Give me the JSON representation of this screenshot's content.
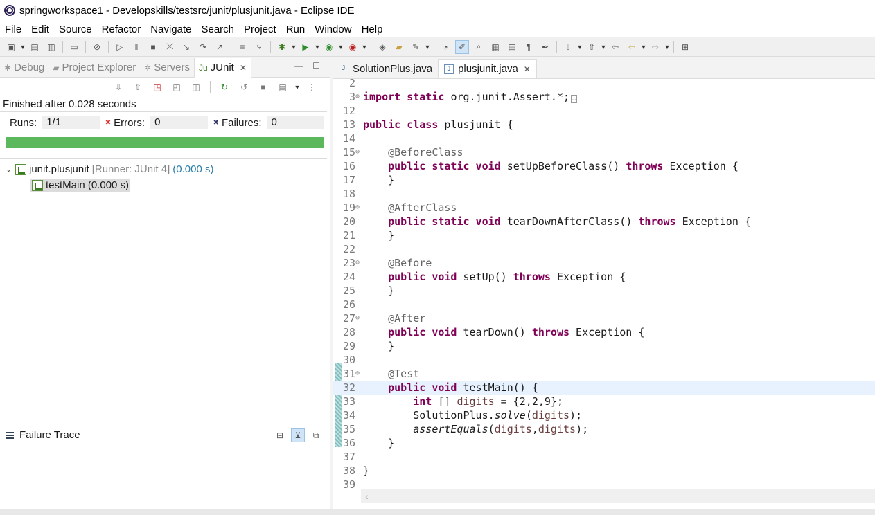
{
  "window": {
    "title": "springworkspace1 - Developskills/testsrc/junit/plusjunit.java - Eclipse IDE"
  },
  "menu": [
    "File",
    "Edit",
    "Source",
    "Refactor",
    "Navigate",
    "Search",
    "Project",
    "Run",
    "Window",
    "Help"
  ],
  "left_tabs": [
    {
      "label": "Debug",
      "icon": "debug-icon"
    },
    {
      "label": "Project Explorer",
      "icon": "project-explorer-icon"
    },
    {
      "label": "Servers",
      "icon": "servers-icon"
    },
    {
      "label": "JUnit",
      "icon": "junit-icon"
    }
  ],
  "junit": {
    "status": "Finished after 0.028 seconds",
    "runs_label": "Runs:",
    "runs": "1/1",
    "errors_label": "Errors:",
    "errors": "0",
    "failures_label": "Failures:",
    "failures": "0",
    "progress_color": "#5cb85c",
    "suite": {
      "name": "junit.plusjunit",
      "runner": "[Runner: JUnit 4]",
      "time": "(0.000 s)"
    },
    "test": {
      "name": "testMain (0.000 s)"
    },
    "failure_trace_label": "Failure Trace"
  },
  "editor_tabs": [
    {
      "label": "SolutionPlus.java"
    },
    {
      "label": "plusjunit.java"
    }
  ],
  "code_lines": [
    {
      "num": "2",
      "fold": "",
      "tokens": []
    },
    {
      "num": "3",
      "fold": "⊕",
      "tokens": [
        [
          "kw",
          "import static"
        ],
        [
          "",
          "org.junit.Assert.*;"
        ],
        [
          "box",
          "…"
        ]
      ]
    },
    {
      "num": "12",
      "fold": "",
      "tokens": []
    },
    {
      "num": "13",
      "fold": "",
      "tokens": [
        [
          "kw",
          "public class"
        ],
        [
          "",
          "plusjunit {"
        ]
      ]
    },
    {
      "num": "14",
      "fold": "",
      "tokens": []
    },
    {
      "num": "15",
      "fold": "⊖",
      "tokens": [
        [
          "",
          "    "
        ],
        [
          "ann",
          "@BeforeClass"
        ]
      ]
    },
    {
      "num": "16",
      "fold": "",
      "tokens": [
        [
          "",
          "    "
        ],
        [
          "kw",
          "public static void"
        ],
        [
          "",
          " setUpBeforeClass() "
        ],
        [
          "kw",
          "throws"
        ],
        [
          "",
          " Exception {"
        ]
      ]
    },
    {
      "num": "17",
      "fold": "",
      "tokens": [
        [
          "",
          "    }"
        ]
      ]
    },
    {
      "num": "18",
      "fold": "",
      "tokens": []
    },
    {
      "num": "19",
      "fold": "⊖",
      "tokens": [
        [
          "",
          "    "
        ],
        [
          "ann",
          "@AfterClass"
        ]
      ]
    },
    {
      "num": "20",
      "fold": "",
      "tokens": [
        [
          "",
          "    "
        ],
        [
          "kw",
          "public static void"
        ],
        [
          "",
          " tearDownAfterClass() "
        ],
        [
          "kw",
          "throws"
        ],
        [
          "",
          " Exception {"
        ]
      ]
    },
    {
      "num": "21",
      "fold": "",
      "tokens": [
        [
          "",
          "    }"
        ]
      ]
    },
    {
      "num": "22",
      "fold": "",
      "tokens": []
    },
    {
      "num": "23",
      "fold": "⊖",
      "tokens": [
        [
          "",
          "    "
        ],
        [
          "ann",
          "@Before"
        ]
      ]
    },
    {
      "num": "24",
      "fold": "",
      "tokens": [
        [
          "",
          "    "
        ],
        [
          "kw",
          "public void"
        ],
        [
          "",
          " setUp() "
        ],
        [
          "kw",
          "throws"
        ],
        [
          "",
          " Exception {"
        ]
      ]
    },
    {
      "num": "25",
      "fold": "",
      "tokens": [
        [
          "",
          "    }"
        ]
      ]
    },
    {
      "num": "26",
      "fold": "",
      "tokens": []
    },
    {
      "num": "27",
      "fold": "⊖",
      "tokens": [
        [
          "",
          "    "
        ],
        [
          "ann",
          "@After"
        ]
      ]
    },
    {
      "num": "28",
      "fold": "",
      "tokens": [
        [
          "",
          "    "
        ],
        [
          "kw",
          "public void"
        ],
        [
          "",
          " tearDown() "
        ],
        [
          "kw",
          "throws"
        ],
        [
          "",
          " Exception {"
        ]
      ]
    },
    {
      "num": "29",
      "fold": "",
      "tokens": [
        [
          "",
          "    }"
        ]
      ]
    },
    {
      "num": "30",
      "fold": "",
      "tokens": []
    },
    {
      "num": "31",
      "fold": "⊖",
      "tokens": [
        [
          "",
          "    "
        ],
        [
          "ann",
          "@Test"
        ]
      ]
    },
    {
      "num": "32",
      "fold": "",
      "current": true,
      "tokens": [
        [
          "",
          "    "
        ],
        [
          "kw",
          "public void"
        ],
        [
          "",
          " testMain() {"
        ]
      ]
    },
    {
      "num": "33",
      "fold": "",
      "tokens": [
        [
          "",
          "        "
        ],
        [
          "kw",
          "int"
        ],
        [
          "",
          "[] "
        ],
        [
          "var",
          "digits"
        ],
        [
          "",
          " = {2,2,9};"
        ]
      ]
    },
    {
      "num": "34",
      "fold": "",
      "tokens": [
        [
          "",
          "        SolutionPlus."
        ],
        [
          "it",
          "solve"
        ],
        [
          "",
          "("
        ],
        [
          "var",
          "digits"
        ],
        [
          "",
          ");"
        ]
      ]
    },
    {
      "num": "35",
      "fold": "",
      "tokens": [
        [
          "",
          "        "
        ],
        [
          "it",
          "assertEquals"
        ],
        [
          "",
          "("
        ],
        [
          "var",
          "digits"
        ],
        [
          "",
          ","
        ],
        [
          "var",
          "digits"
        ],
        [
          "",
          ");"
        ]
      ]
    },
    {
      "num": "36",
      "fold": "",
      "tokens": [
        [
          "",
          "    }"
        ]
      ]
    },
    {
      "num": "37",
      "fold": "",
      "tokens": []
    },
    {
      "num": "38",
      "fold": "",
      "tokens": [
        [
          "",
          "}"
        ]
      ]
    },
    {
      "num": "39",
      "fold": "",
      "tokens": []
    }
  ]
}
